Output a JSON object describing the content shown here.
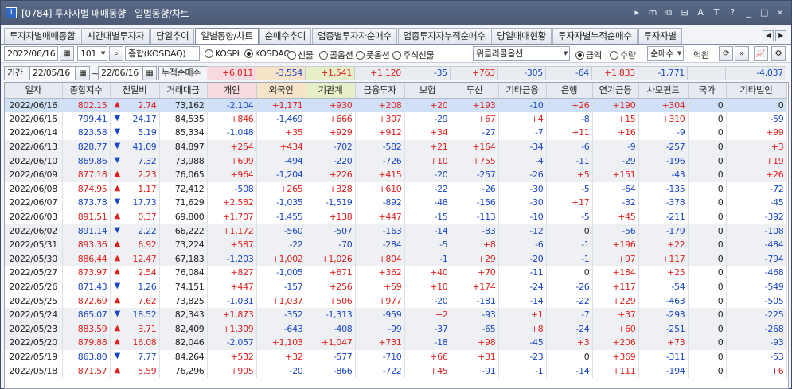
{
  "window": {
    "num": "1",
    "title": "[0784] 투자자별 매매동향 - 일별동향/차트",
    "buttons": [
      "▸",
      "m",
      "⧉",
      "⊟",
      "A",
      "T",
      "?",
      "_",
      "□",
      "×"
    ]
  },
  "tabs": [
    "투자자별매매종합",
    "시간대별투자자",
    "당일추이",
    "일별동향/차트",
    "순매수추이",
    "업종별투자자순매수",
    "업종투자자누적순매수",
    "당일매매현황",
    "투자자별누적순매수",
    "투자자별"
  ],
  "active_tab": 3,
  "tab_arrows": [
    "◀",
    "▶"
  ],
  "toolbar": {
    "date": "2022/06/16",
    "code": "101",
    "market": "종합(KOSDAQ)",
    "radios": [
      {
        "label": "KOSPI",
        "on": false
      },
      {
        "label": "KOSDAQ",
        "on": true
      },
      {
        "label": "선물",
        "on": false
      },
      {
        "label": "콜옵션",
        "on": false
      },
      {
        "label": "풋옵션",
        "on": false
      },
      {
        "label": "주식선물",
        "on": false
      }
    ],
    "option_sel": "위클리콜옵션",
    "radios2": [
      {
        "label": "금액",
        "on": true
      },
      {
        "label": "수량",
        "on": false
      }
    ],
    "mode": "순매수",
    "unit": "억원"
  },
  "period": {
    "label": "기간",
    "from": "22/05/16",
    "to": "22/06/16",
    "sumlabel": "누적순매수",
    "sums": [
      "+6,011",
      "-3,554",
      "+1,541",
      "+1,120",
      "-35",
      "+763",
      "-305",
      "-64",
      "+1,833",
      "-1,771",
      "",
      "-4,037"
    ]
  },
  "columns": [
    "일자",
    "종합지수",
    "전일비",
    "거래대금",
    "개인",
    "외국인",
    "기관계",
    "금융투자",
    "보험",
    "투신",
    "기타금융",
    "은행",
    "연기금등",
    "사모펀드",
    "국가",
    "기타법인"
  ],
  "rows": [
    [
      "2022/06/16",
      "802.15",
      "▲",
      "2.74",
      "73,162",
      "-2,104",
      "+1,171",
      "+930",
      "+208",
      "+20",
      "+193",
      "-10",
      "+26",
      "+190",
      "+304",
      "0",
      "0"
    ],
    [
      "2022/06/15",
      "799.41",
      "▼",
      "24.17",
      "84,535",
      "+846",
      "-1,469",
      "+666",
      "+307",
      "-29",
      "+67",
      "+4",
      "-8",
      "+15",
      "+310",
      "0",
      "-59"
    ],
    [
      "2022/06/14",
      "823.58",
      "▼",
      "5.19",
      "85,334",
      "-1,048",
      "+35",
      "+929",
      "+912",
      "+34",
      "-27",
      "-7",
      "+11",
      "+16",
      "-9",
      "0",
      "+99"
    ],
    [
      "2022/06/13",
      "828.77",
      "▼",
      "41.09",
      "84,897",
      "+254",
      "+434",
      "-702",
      "-582",
      "+21",
      "+164",
      "-34",
      "-6",
      "-9",
      "-257",
      "0",
      "+3"
    ],
    [
      "2022/06/10",
      "869.86",
      "▼",
      "7.32",
      "73,988",
      "+699",
      "-494",
      "-220",
      "-726",
      "+10",
      "+755",
      "-4",
      "-11",
      "-29",
      "-196",
      "0",
      "+19"
    ],
    [
      "2022/06/09",
      "877.18",
      "▲",
      "2.23",
      "76,065",
      "+964",
      "-1,204",
      "+226",
      "+415",
      "-20",
      "-257",
      "-26",
      "+5",
      "+151",
      "-43",
      "0",
      "+26"
    ],
    [
      "2022/06/08",
      "874.95",
      "▲",
      "1.17",
      "72,412",
      "-508",
      "+265",
      "+328",
      "+610",
      "-22",
      "-26",
      "-30",
      "-5",
      "-64",
      "-135",
      "0",
      "-72"
    ],
    [
      "2022/06/07",
      "873.78",
      "▼",
      "17.73",
      "71,629",
      "+2,582",
      "-1,035",
      "-1,519",
      "-892",
      "-48",
      "-156",
      "-30",
      "+17",
      "-32",
      "-378",
      "0",
      "-45"
    ],
    [
      "2022/06/03",
      "891.51",
      "▲",
      "0.37",
      "69,800",
      "+1,707",
      "-1,455",
      "+138",
      "+447",
      "-15",
      "-113",
      "-10",
      "-5",
      "+45",
      "-211",
      "0",
      "-392"
    ],
    [
      "2022/06/02",
      "891.14",
      "▼",
      "2.22",
      "66,222",
      "+1,172",
      "-560",
      "-507",
      "-163",
      "-14",
      "-83",
      "-12",
      "0",
      "-56",
      "-179",
      "0",
      "-108"
    ],
    [
      "2022/05/31",
      "893.36",
      "▲",
      "6.92",
      "73,224",
      "+587",
      "-22",
      "-70",
      "-284",
      "-5",
      "+8",
      "-6",
      "-1",
      "+196",
      "+22",
      "0",
      "-484"
    ],
    [
      "2022/05/30",
      "886.44",
      "▲",
      "12.47",
      "67,183",
      "-1,203",
      "+1,002",
      "+1,026",
      "+804",
      "-1",
      "+29",
      "-20",
      "-1",
      "+97",
      "+117",
      "0",
      "-794"
    ],
    [
      "2022/05/27",
      "873.97",
      "▲",
      "2.54",
      "76,084",
      "+827",
      "-1,005",
      "+671",
      "+362",
      "+40",
      "+70",
      "-11",
      "0",
      "+184",
      "+25",
      "0",
      "-468"
    ],
    [
      "2022/05/26",
      "871.43",
      "▼",
      "1.26",
      "74,151",
      "+447",
      "-157",
      "+256",
      "+59",
      "+10",
      "+174",
      "-24",
      "-26",
      "+117",
      "-54",
      "0",
      "-549"
    ],
    [
      "2022/05/25",
      "872.69",
      "▲",
      "7.62",
      "73,825",
      "-1,031",
      "+1,037",
      "+506",
      "+977",
      "-20",
      "-181",
      "-14",
      "-22",
      "+229",
      "-463",
      "0",
      "-505"
    ],
    [
      "2022/05/24",
      "865.07",
      "▼",
      "18.52",
      "82,343",
      "+1,873",
      "-352",
      "-1,313",
      "-959",
      "+2",
      "-93",
      "+1",
      "-7",
      "+37",
      "-293",
      "0",
      "-225"
    ],
    [
      "2022/05/23",
      "883.59",
      "▲",
      "3.71",
      "82,409",
      "+1,309",
      "-643",
      "-408",
      "-99",
      "-37",
      "-65",
      "+8",
      "-24",
      "+60",
      "-251",
      "0",
      "-268"
    ],
    [
      "2022/05/20",
      "879.88",
      "▲",
      "16.08",
      "82,046",
      "-2,057",
      "+1,103",
      "+1,047",
      "+731",
      "-18",
      "+98",
      "-45",
      "+3",
      "+206",
      "+73",
      "0",
      "-93"
    ],
    [
      "2022/05/19",
      "863.80",
      "▼",
      "7.77",
      "84,264",
      "+532",
      "+32",
      "-577",
      "-710",
      "+66",
      "+31",
      "-23",
      "0",
      "+369",
      "-311",
      "0",
      "-53"
    ],
    [
      "2022/05/18",
      "871.57",
      "▲",
      "5.59",
      "76,296",
      "+905",
      "-20",
      "-866",
      "-722",
      "+45",
      "-91",
      "-1",
      "-14",
      "+111",
      "-194",
      "0",
      "+6"
    ]
  ]
}
